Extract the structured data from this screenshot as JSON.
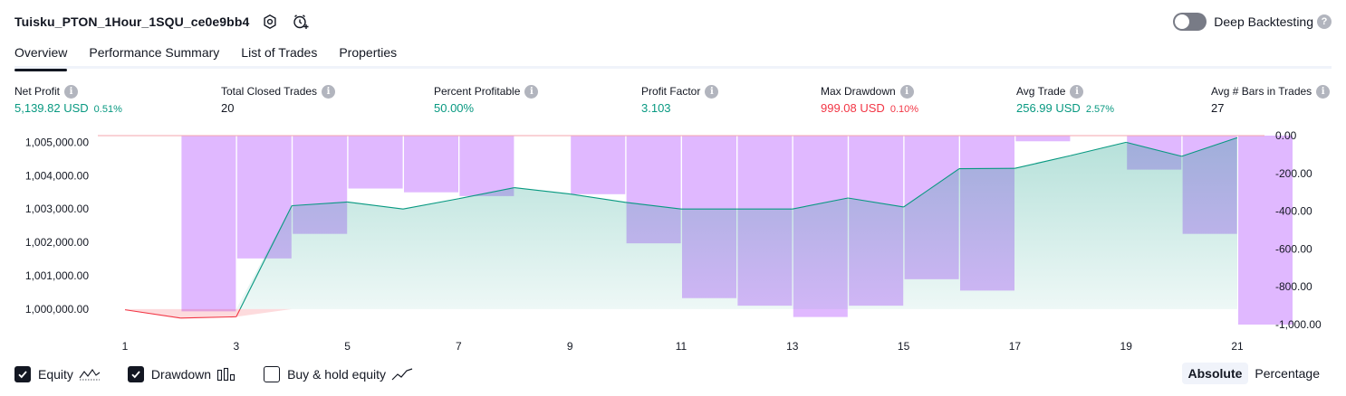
{
  "header": {
    "title": "Tuisku_PTON_1Hour_1SQU_ce0e9bb4"
  },
  "deep_backtesting": {
    "label": "Deep Backtesting",
    "enabled": false
  },
  "tabs": [
    {
      "label": "Overview"
    },
    {
      "label": "Performance Summary"
    },
    {
      "label": "List of Trades"
    },
    {
      "label": "Properties"
    }
  ],
  "metrics": [
    {
      "label": "Net Profit",
      "value": "5,139.82 USD",
      "pct": "0.51%",
      "color": "#089981"
    },
    {
      "label": "Total Closed Trades",
      "value": "20",
      "pct": "",
      "color": "#131722"
    },
    {
      "label": "Percent Profitable",
      "value": "50.00%",
      "pct": "",
      "color": "#089981"
    },
    {
      "label": "Profit Factor",
      "value": "3.103",
      "pct": "",
      "color": "#089981"
    },
    {
      "label": "Max Drawdown",
      "value": "999.08 USD",
      "pct": "0.10%",
      "color": "#f23645"
    },
    {
      "label": "Avg Trade",
      "value": "256.99 USD",
      "pct": "2.57%",
      "color": "#089981"
    },
    {
      "label": "Avg # Bars in Trades",
      "value": "27",
      "pct": "",
      "color": "#131722"
    }
  ],
  "chart_data": {
    "type": "area",
    "x": [
      1,
      2,
      3,
      4,
      5,
      6,
      7,
      8,
      9,
      10,
      11,
      12,
      13,
      14,
      15,
      16,
      17,
      18,
      19,
      20,
      21
    ],
    "x_tick_labels": [
      "1",
      "3",
      "5",
      "7",
      "9",
      "11",
      "13",
      "15",
      "17",
      "19",
      "21"
    ],
    "left_axis": {
      "ylim": [
        999000,
        1005200
      ],
      "tick_labels": [
        "1,005,000.00",
        "1,004,000.00",
        "1,003,000.00",
        "1,002,000.00",
        "1,001,000.00",
        "1,000,000.00"
      ],
      "tick_values": [
        1005000,
        1004000,
        1003000,
        1002000,
        1001000,
        1000000
      ]
    },
    "right_axis": {
      "ylim": [
        -1000,
        0
      ],
      "tick_labels": [
        "0.00",
        "-200.00",
        "-400.00",
        "-600.00",
        "-800.00",
        "-1,000.00"
      ],
      "tick_values": [
        0,
        -200,
        -400,
        -600,
        -800,
        -1000
      ]
    },
    "series": [
      {
        "name": "Equity",
        "color": "#089981",
        "negative_color": "#f23645",
        "baseline": 1000000,
        "values": [
          999980,
          999730,
          999770,
          1003100,
          1003210,
          1003000,
          1003310,
          1003640,
          1003450,
          1003200,
          1003000,
          1003000,
          1003000,
          1003330,
          1003060,
          1004210,
          1004220,
          1004600,
          1005000,
          1004580,
          1005140
        ]
      },
      {
        "name": "Drawdown",
        "color": "#c77dff",
        "values": [
          0,
          -930,
          -650,
          -520,
          -280,
          -300,
          -320,
          0,
          -310,
          -570,
          -860,
          -900,
          -960,
          -900,
          -760,
          -820,
          -30,
          0,
          -180,
          -520,
          -1000
        ]
      }
    ]
  },
  "legend": [
    {
      "label": "Equity",
      "checked": true
    },
    {
      "label": "Drawdown",
      "checked": true
    },
    {
      "label": "Buy & hold equity",
      "checked": false
    }
  ],
  "view_modes": [
    {
      "label": "Absolute",
      "active": true
    },
    {
      "label": "Percentage",
      "active": false
    }
  ]
}
